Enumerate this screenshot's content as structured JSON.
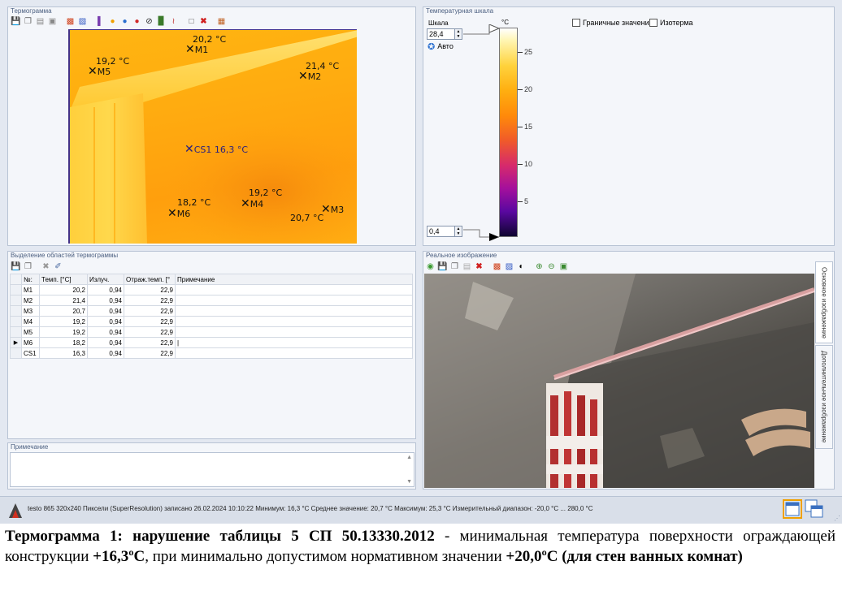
{
  "thermogram_panel": {
    "title": "Термограмма",
    "markers": [
      {
        "id": "M1",
        "value": "20,2 °C"
      },
      {
        "id": "M2",
        "value": "21,4 °C"
      },
      {
        "id": "M3",
        "value": "20,7 °C"
      },
      {
        "id": "M4",
        "value": "19,2 °C"
      },
      {
        "id": "M5",
        "value": "19,2 °C"
      },
      {
        "id": "M6",
        "value": "18,2 °C"
      },
      {
        "id": "CS1",
        "value": "CS1 16,3 °C"
      }
    ]
  },
  "scale_panel": {
    "title": "Температурная шкала",
    "scale_label": "Шкала",
    "max_value": "28,4",
    "min_value": "0,4",
    "auto_button": "Авто",
    "unit": "°C",
    "ticks": [
      "25",
      "20",
      "15",
      "10",
      "5"
    ],
    "boundary_values_label": "Граничные значения",
    "isotherm_label": "Изотерма"
  },
  "regions_panel": {
    "title": "Выделение областей термограммы",
    "columns": [
      "№:",
      "Темп. [°C]",
      "Излуч.",
      "Отраж.темп. [°",
      "Примечание"
    ],
    "rows": [
      {
        "id": "M1",
        "temp": "20,2",
        "emis": "0,94",
        "refl": "22,9",
        "note": ""
      },
      {
        "id": "M2",
        "temp": "21,4",
        "emis": "0,94",
        "refl": "22,9",
        "note": ""
      },
      {
        "id": "M3",
        "temp": "20,7",
        "emis": "0,94",
        "refl": "22,9",
        "note": ""
      },
      {
        "id": "M4",
        "temp": "19,2",
        "emis": "0,94",
        "refl": "22,9",
        "note": ""
      },
      {
        "id": "M5",
        "temp": "19,2",
        "emis": "0,94",
        "refl": "22,9",
        "note": ""
      },
      {
        "id": "M6",
        "temp": "18,2",
        "emis": "0,94",
        "refl": "22,9",
        "note": "|"
      },
      {
        "id": "CS1",
        "temp": "16,3",
        "emis": "0,94",
        "refl": "22,9",
        "note": ""
      }
    ]
  },
  "note_panel": {
    "title": "Примечание"
  },
  "real_image_panel": {
    "title": "Реальное изображение",
    "tab_main": "Основное изображение",
    "tab_extra": "Дополнительное изображение"
  },
  "status_bar": {
    "text": "testo 865 320x240 Пиксели (SuperResolution) записано 26.02.2024 10:10:22 Минимум: 16,3 °C Среднее значение: 20,7 °C Максимум: 25,3 °C Измерительный диапазон: -20,0 °C ... 280,0 °C"
  },
  "caption": {
    "bold_part": "Термограмма  1: нарушение таблицы 5 СП 50.13330.2012",
    "text_part1": " - минимальная температура поверхности ограждающей конструкции ",
    "bold_min": "+16,3ºС",
    "text_part2": ", при минимально допустимом нормативном значении ",
    "bold_norm": "+20,0ºС (для стен ванных комнат)"
  },
  "colors": {
    "window_bg": "#e3e8f1",
    "panel_bg": "#f4f6fa",
    "panel_border": "#b8c3d4",
    "title_text": "#4b5f80",
    "thermo_orange": "#ffac10"
  }
}
